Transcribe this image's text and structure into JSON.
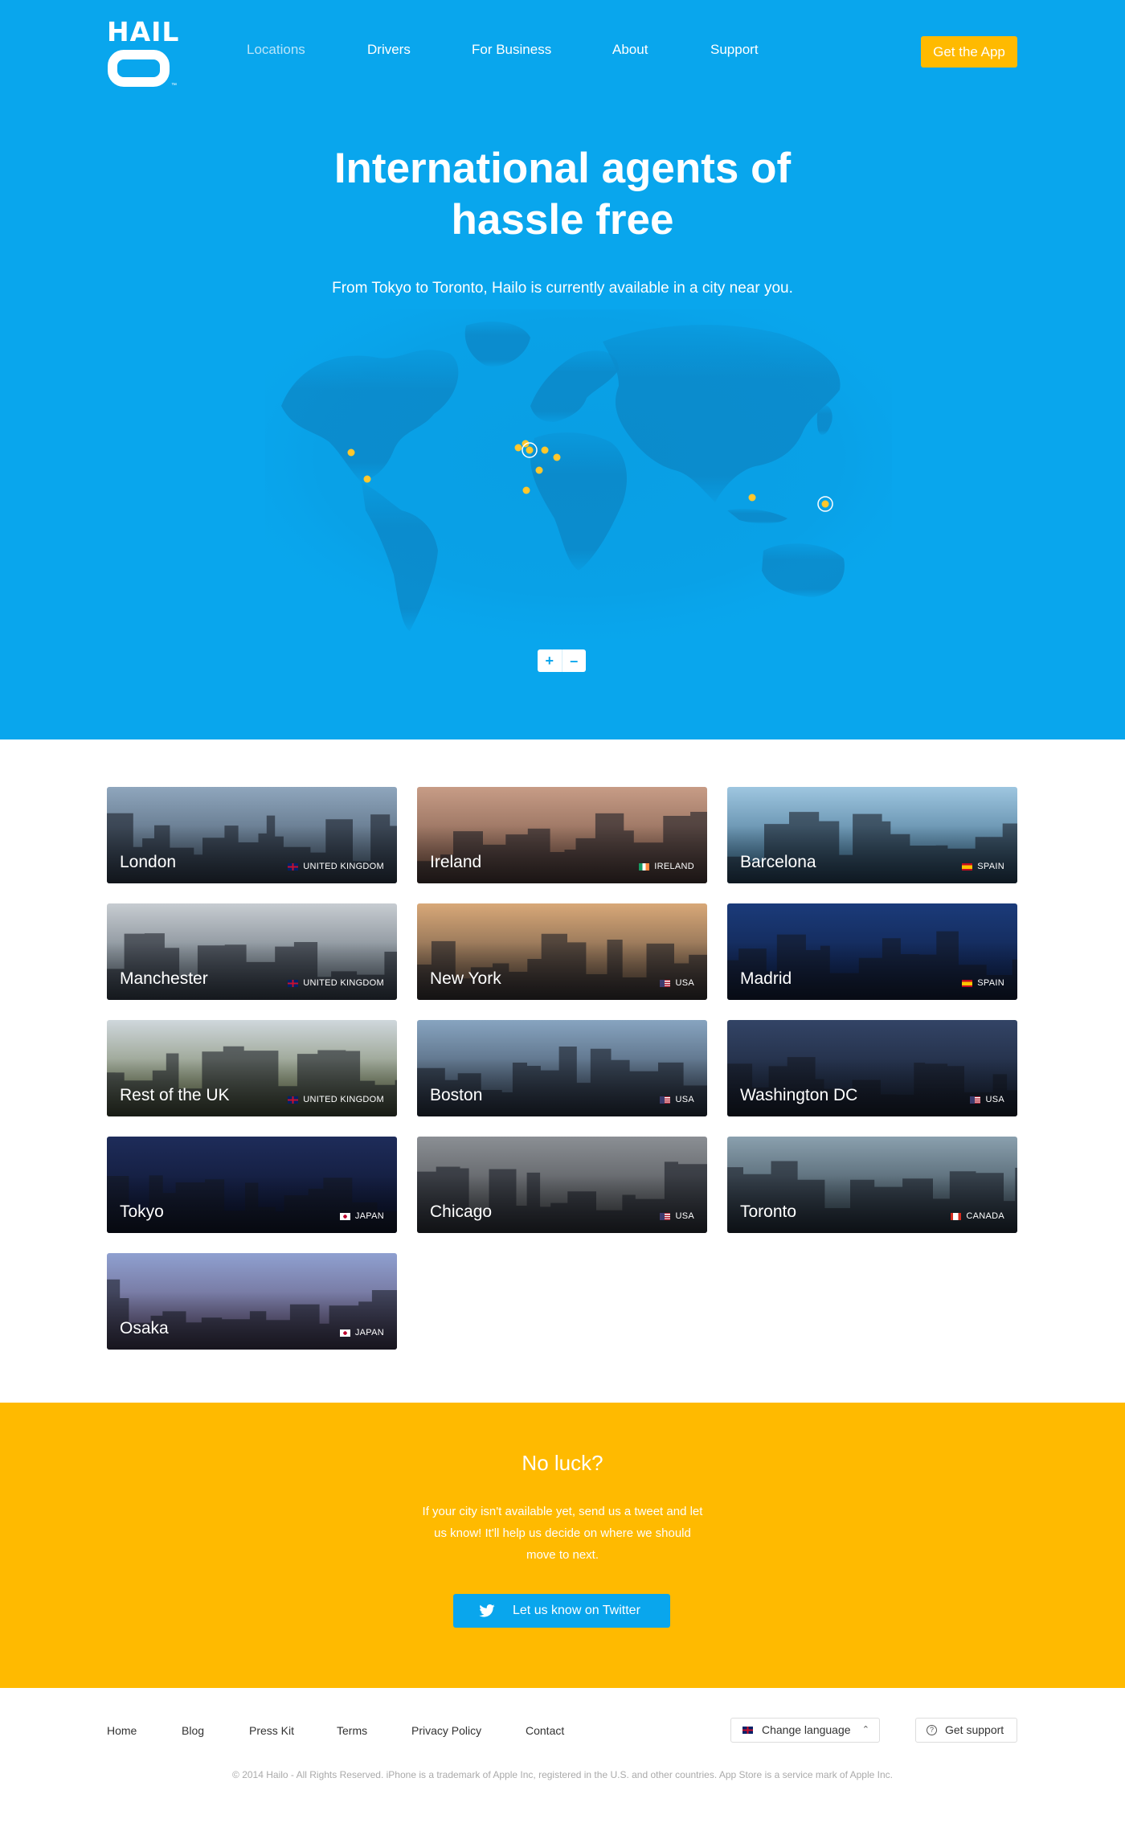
{
  "brand": {
    "logo_word": "HAIL",
    "tm": "™"
  },
  "nav": {
    "items": [
      {
        "label": "Locations",
        "active": true
      },
      {
        "label": "Drivers"
      },
      {
        "label": "For Business"
      },
      {
        "label": "About"
      },
      {
        "label": "Support"
      }
    ],
    "cta": "Get the App"
  },
  "hero": {
    "title_line1": "International agents of",
    "title_line2": "hassle free",
    "subtitle": "From Tokyo to Toronto, Hailo is currently available in a city near you.",
    "zoom_in": "+",
    "zoom_out": "–"
  },
  "cities": [
    {
      "name": "London",
      "country": "UNITED KINGDOM",
      "flag": "uk"
    },
    {
      "name": "Ireland",
      "country": "IRELAND",
      "flag": "ie"
    },
    {
      "name": "Barcelona",
      "country": "SPAIN",
      "flag": "es"
    },
    {
      "name": "Manchester",
      "country": "UNITED KINGDOM",
      "flag": "uk"
    },
    {
      "name": "New York",
      "country": "USA",
      "flag": "us"
    },
    {
      "name": "Madrid",
      "country": "SPAIN",
      "flag": "es"
    },
    {
      "name": "Rest of the UK",
      "country": "UNITED KINGDOM",
      "flag": "uk"
    },
    {
      "name": "Boston",
      "country": "USA",
      "flag": "us"
    },
    {
      "name": "Washington DC",
      "country": "USA",
      "flag": "us"
    },
    {
      "name": "Tokyo",
      "country": "JAPAN",
      "flag": "jp"
    },
    {
      "name": "Chicago",
      "country": "USA",
      "flag": "us"
    },
    {
      "name": "Toronto",
      "country": "CANADA",
      "flag": "ca"
    },
    {
      "name": "Osaka",
      "country": "JAPAN",
      "flag": "jp"
    }
  ],
  "noluck": {
    "title": "No luck?",
    "text": "If your city isn't available yet, send us a tweet and let us know! It'll help us decide on where we should move to next.",
    "button": "Let us know on Twitter"
  },
  "footer": {
    "links": [
      "Home",
      "Blog",
      "Press Kit",
      "Terms",
      "Privacy Policy",
      "Contact"
    ],
    "change_language": "Change language",
    "get_support": "Get support",
    "copyright": "© 2014 Hailo - All Rights Reserved. iPhone is a trademark of Apple Inc, registered in the U.S. and other countries. App Store is a service mark of Apple Inc."
  },
  "colors": {
    "blue": "#09a6ed",
    "yellow": "#ffba00",
    "pin": "#ffc72c"
  }
}
